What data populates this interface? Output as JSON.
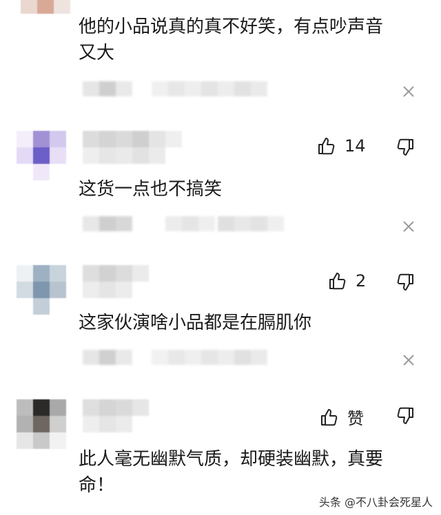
{
  "comments": [
    {
      "text": "他的小品说真的真不好笑，有点吵声音又大",
      "line1": "他的小品说真的真不好笑，有点吵声音",
      "line2": "又大"
    },
    {
      "text": "这货一点也不搞笑",
      "likes": "14"
    },
    {
      "text": "这家伙演啥小品都是在膈肌你",
      "likes": "2"
    },
    {
      "text": "此人毫无幽默气质，却硬装幽默，真要命！",
      "line1": "此人毫无幽默气质，却硬装幽默，真要",
      "line2": "命！",
      "likes": "赞"
    }
  ],
  "watermark": "头条 @不八卦会死星人",
  "icons": {
    "like": "thumbs-up-icon",
    "dislike": "thumbs-down-icon",
    "close": "close-icon"
  }
}
